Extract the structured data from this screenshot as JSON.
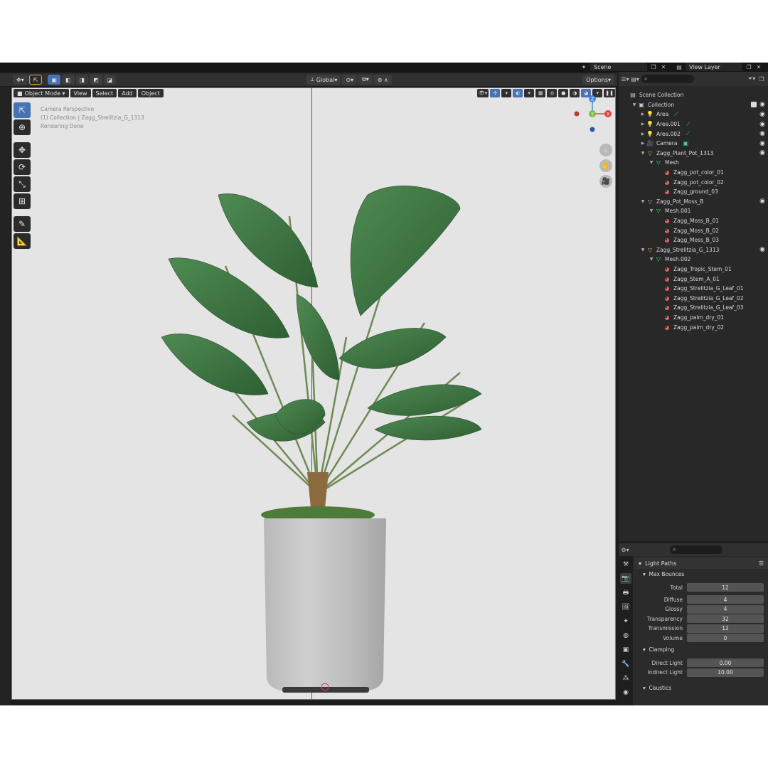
{
  "topbar": {
    "scene_label": "Scene",
    "view_layer_label": "View Layer"
  },
  "viewport_header": {
    "transform_orientation": "Global",
    "options_label": "Options"
  },
  "viewport_menu": {
    "mode": "Object Mode",
    "menus": [
      "View",
      "Select",
      "Add",
      "Object"
    ]
  },
  "viewport_overlay": {
    "line1": "Camera Perspective",
    "line2": "(1) Collection | Zagg_Strelitzia_G_1313",
    "line3": "Rendering Done"
  },
  "gizmo": {
    "z": "Z",
    "y": "Y",
    "x": "X"
  },
  "outliner": {
    "search_placeholder": "",
    "rows": [
      {
        "label": "Scene Collection",
        "indent": 0,
        "icon": "scene-collection-icon",
        "tri": ""
      },
      {
        "label": "Collection",
        "indent": 1,
        "icon": "collection-icon",
        "tri": "▼"
      },
      {
        "label": "Area",
        "indent": 2,
        "icon": "light-icon",
        "tri": "▶"
      },
      {
        "label": "Area.001",
        "indent": 2,
        "icon": "light-icon",
        "tri": "▶"
      },
      {
        "label": "Area.002",
        "indent": 2,
        "icon": "light-icon",
        "tri": "▶"
      },
      {
        "label": "Camera",
        "indent": 2,
        "icon": "camera-icon",
        "tri": "▶"
      },
      {
        "label": "Zagg_Plant_Pot_1313",
        "indent": 2,
        "icon": "object-icon",
        "tri": "▼"
      },
      {
        "label": "Mesh",
        "indent": 3,
        "icon": "mesh-icon",
        "tri": "▼"
      },
      {
        "label": "Zagg_pot_color_01",
        "indent": 4,
        "icon": "material-icon",
        "tri": ""
      },
      {
        "label": "Zagg_pot_color_02",
        "indent": 4,
        "icon": "material-icon",
        "tri": ""
      },
      {
        "label": "Zagg_ground_03",
        "indent": 4,
        "icon": "material-icon",
        "tri": ""
      },
      {
        "label": "Zagg_Pot_Moss_B",
        "indent": 2,
        "icon": "object-icon",
        "tri": "▼"
      },
      {
        "label": "Mesh.001",
        "indent": 3,
        "icon": "mesh-icon",
        "tri": "▼"
      },
      {
        "label": "Zagg_Moss_B_01",
        "indent": 4,
        "icon": "material-icon",
        "tri": ""
      },
      {
        "label": "Zagg_Moss_B_02",
        "indent": 4,
        "icon": "material-icon",
        "tri": ""
      },
      {
        "label": "Zagg_Moss_B_03",
        "indent": 4,
        "icon": "material-icon",
        "tri": ""
      },
      {
        "label": "Zagg_Strelitzia_G_1313",
        "indent": 2,
        "icon": "object-icon",
        "tri": "▼"
      },
      {
        "label": "Mesh.002",
        "indent": 3,
        "icon": "mesh-icon",
        "tri": "▼"
      },
      {
        "label": "Zagg_Tropic_Stem_01",
        "indent": 4,
        "icon": "material-icon",
        "tri": ""
      },
      {
        "label": "Zagg_Stem_A_01",
        "indent": 4,
        "icon": "material-icon",
        "tri": ""
      },
      {
        "label": "Zagg_Strelitzia_G_Leaf_01",
        "indent": 4,
        "icon": "material-icon",
        "tri": ""
      },
      {
        "label": "Zagg_Strelitzia_G_Leaf_02",
        "indent": 4,
        "icon": "material-icon",
        "tri": ""
      },
      {
        "label": "Zagg_Strelitzia_G_Leaf_03",
        "indent": 4,
        "icon": "material-icon",
        "tri": ""
      },
      {
        "label": "Zagg_palm_dry_01",
        "indent": 4,
        "icon": "material-icon",
        "tri": ""
      },
      {
        "label": "Zagg_palm_dry_02",
        "indent": 4,
        "icon": "material-icon",
        "tri": ""
      }
    ]
  },
  "properties": {
    "light_paths": "Light Paths",
    "max_bounces": "Max Bounces",
    "total_label": "Total",
    "total": "12",
    "diffuse_label": "Diffuse",
    "diffuse": "4",
    "glossy_label": "Glossy",
    "glossy": "4",
    "transparency_label": "Transparency",
    "transparency": "32",
    "transmission_label": "Transmission",
    "transmission": "12",
    "volume_label": "Volume",
    "volume": "0",
    "clamping": "Clamping",
    "direct_light_label": "Direct Light",
    "direct_light": "0.00",
    "indirect_light_label": "Indirect Light",
    "indirect_light": "10.00",
    "caustics": "Caustics"
  },
  "colors": {
    "accent": "#4772b3",
    "viewport_bg": "#e4e4e4",
    "panel_bg": "#282828"
  }
}
